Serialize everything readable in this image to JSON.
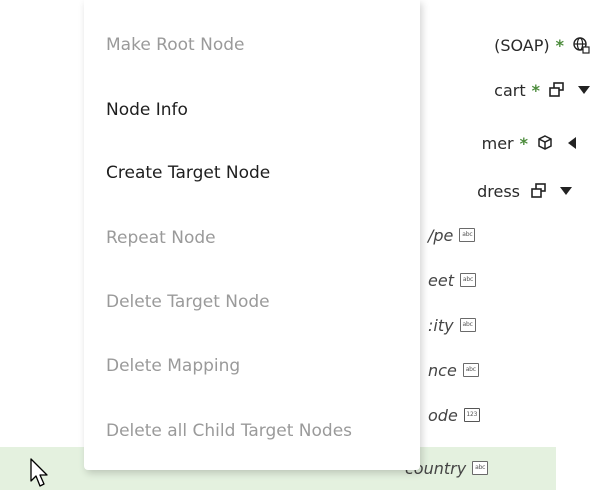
{
  "context_menu": {
    "items": [
      {
        "label": "Make Root Node",
        "enabled": false
      },
      {
        "label": "Node Info",
        "enabled": true
      },
      {
        "label": "Create Target Node",
        "enabled": true
      },
      {
        "label": "Repeat Node",
        "enabled": false
      },
      {
        "label": "Delete Target Node",
        "enabled": false
      },
      {
        "label": "Delete Mapping",
        "enabled": false
      },
      {
        "label": "Delete all Child Target Nodes",
        "enabled": false
      }
    ]
  },
  "tree": {
    "soap": {
      "label": "(SOAP)",
      "required": "*",
      "icon": "globe-icon"
    },
    "cart": {
      "label": "cart",
      "required": "*",
      "icon": "collection-icon",
      "toggle": "expanded"
    },
    "customer": {
      "label": "mer",
      "required": "*",
      "icon": "cube-icon",
      "toggle": "collapsed"
    },
    "address": {
      "label": "dress",
      "icon": "collection-icon",
      "toggle": "expanded"
    },
    "type": {
      "label": "/pe",
      "icon": "string-type-icon",
      "icon_text": "abc"
    },
    "street": {
      "label": "eet",
      "icon": "string-type-icon",
      "icon_text": "abc"
    },
    "city": {
      "label": ":ity",
      "icon": "string-type-icon",
      "icon_text": "abc"
    },
    "province": {
      "label": "nce",
      "icon": "string-type-icon",
      "icon_text": "abc"
    },
    "zip": {
      "label": "ode",
      "icon": "number-type-icon",
      "icon_text": "123"
    },
    "country": {
      "label": "country",
      "icon": "string-type-icon",
      "icon_text": "abc",
      "selected": true
    }
  },
  "colors": {
    "required_marker": "#4b8b3b",
    "selected_row": "#e4f1df",
    "disabled_text": "#9a9a9a",
    "enabled_text": "#1e1e1e"
  }
}
